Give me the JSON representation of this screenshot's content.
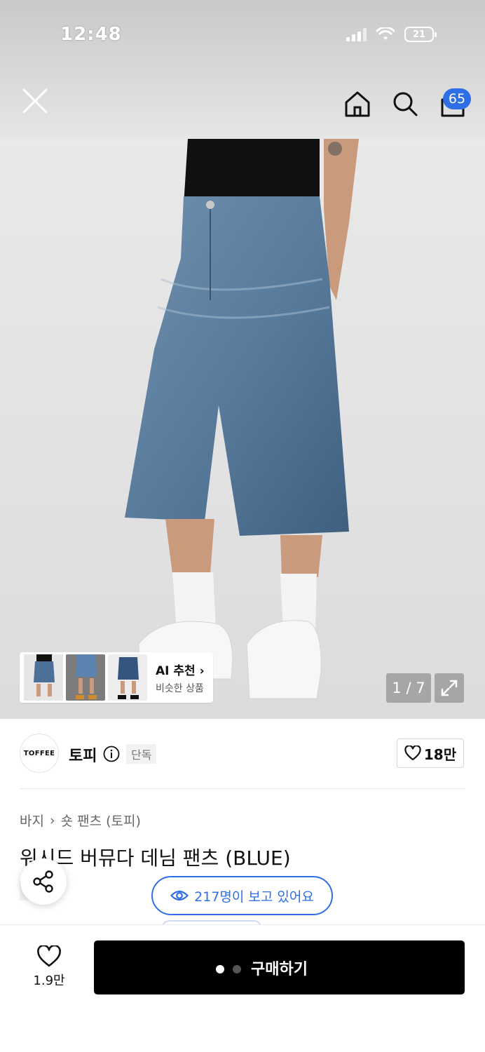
{
  "status_bar": {
    "time": "12:48",
    "battery": "21"
  },
  "nav": {
    "cart_count": "65"
  },
  "gallery": {
    "counter": "1 / 7",
    "ai_recommend": {
      "title": "AI 추천",
      "subtitle": "비슷한 상품"
    }
  },
  "brand": {
    "logo_text": "TOFFEE",
    "name": "토피",
    "badge": "단독",
    "like_count": "18만"
  },
  "product": {
    "breadcrumb": [
      "바지",
      "숏 팬츠 (토피)"
    ],
    "title": "워시드 버뮤다 데님 팬츠 (BLUE)",
    "badge": "단독",
    "viewers": "217명이 보고 있어요"
  },
  "bottom": {
    "wish_count": "1.9만",
    "buy_label": "구매하기"
  },
  "colors": {
    "accent": "#2f6fe6",
    "buy_button": "#000000",
    "denim": "#5d7f9e"
  }
}
